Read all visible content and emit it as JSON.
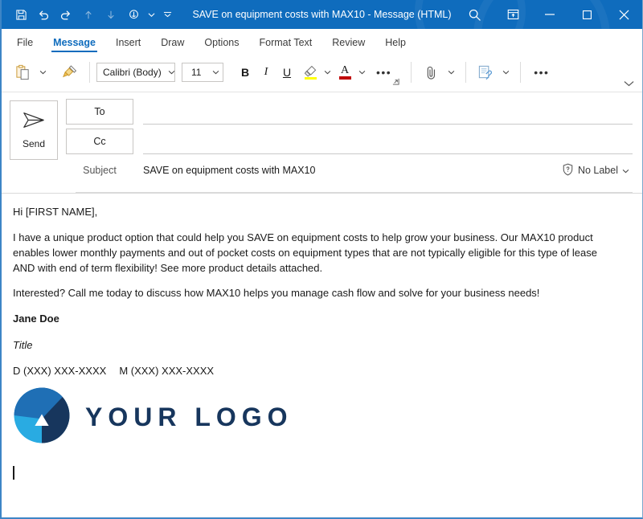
{
  "window": {
    "title": "SAVE on equipment costs with MAX10  -  Message (HTML)",
    "accent_color": "#0f6cbd",
    "border_color": "#3d85c6"
  },
  "quick_access": {
    "items": [
      {
        "name": "save-icon",
        "glyph": "⬚",
        "label": "Save",
        "dim": false
      },
      {
        "name": "undo-icon",
        "glyph": "↶",
        "label": "Undo",
        "dim": false
      },
      {
        "name": "redo-icon",
        "glyph": "↻",
        "label": "Redo",
        "dim": false
      },
      {
        "name": "move-up-icon",
        "glyph": "↑",
        "label": "Previous Item",
        "dim": true
      },
      {
        "name": "move-down-icon",
        "glyph": "↓",
        "label": "Next Item",
        "dim": true
      },
      {
        "name": "touch-mode-icon",
        "glyph": "☝",
        "label": "Touch/Mouse Mode",
        "dim": false
      },
      {
        "name": "touch-mode-caret-icon",
        "glyph": "ˇ",
        "label": "Touch Mode Options",
        "dim": false
      },
      {
        "name": "customize-qat-icon",
        "glyph": "⌄",
        "label": "Customize Quick Access Toolbar",
        "dim": false
      }
    ]
  },
  "window_controls": [
    {
      "name": "search-icon",
      "glyph": "⌕",
      "label": "Search"
    },
    {
      "name": "ribbon-display-options-icon",
      "glyph": "⧉",
      "label": "Ribbon Display Options"
    },
    {
      "name": "minimize-button",
      "glyph": "─",
      "label": "Minimize"
    },
    {
      "name": "maximize-button",
      "glyph": "□",
      "label": "Maximize"
    },
    {
      "name": "close-button",
      "glyph": "✕",
      "label": "Close"
    }
  ],
  "tabs": [
    {
      "id": "file",
      "label": "File",
      "active": false
    },
    {
      "id": "message",
      "label": "Message",
      "active": true
    },
    {
      "id": "insert",
      "label": "Insert",
      "active": false
    },
    {
      "id": "draw",
      "label": "Draw",
      "active": false
    },
    {
      "id": "options",
      "label": "Options",
      "active": false
    },
    {
      "id": "format-text",
      "label": "Format Text",
      "active": false
    },
    {
      "id": "review",
      "label": "Review",
      "active": false
    },
    {
      "id": "help",
      "label": "Help",
      "active": false
    }
  ],
  "ribbon": {
    "paste": {
      "icon": "paste-icon",
      "label": "Paste"
    },
    "format_painter": {
      "icon": "format-painter-icon",
      "label": "Format Painter"
    },
    "font_name": {
      "value": "Calibri (Body)",
      "label": "Font"
    },
    "font_size": {
      "value": "11",
      "label": "Font Size"
    },
    "bold": {
      "label": "B",
      "title": "Bold"
    },
    "italic": {
      "label": "I",
      "title": "Italic"
    },
    "underline": {
      "label": "U",
      "title": "Underline"
    },
    "highlight": {
      "label": "Text Highlight Color",
      "color": "#ffff00"
    },
    "font_color": {
      "label": "A",
      "title": "Font Color",
      "color": "#c00000"
    },
    "more_font": {
      "label": "•••",
      "title": "More Font Commands"
    },
    "font_launcher": {
      "label": "⬌",
      "title": "Font Dialog"
    },
    "attach_file": {
      "icon": "paperclip-icon",
      "label": "Attach File"
    },
    "sensitivity": {
      "icon": "sensitivity-icon",
      "label": "Sensitivity"
    },
    "more_commands": {
      "label": "•••",
      "title": "More Commands"
    },
    "collapse": {
      "label": "⌄",
      "title": "Collapse the Ribbon"
    }
  },
  "compose": {
    "send_button": {
      "label": "Send",
      "icon": "paper-plane-icon"
    },
    "to": {
      "label": "To",
      "value": "",
      "placeholder": ""
    },
    "cc": {
      "label": "Cc",
      "value": "",
      "placeholder": ""
    },
    "subject": {
      "label": "Subject",
      "value": "SAVE on equipment costs with MAX10",
      "placeholder": ""
    },
    "sensitivity_label": {
      "text": "No Label",
      "icon": "shield-question-icon",
      "caret": "ˇ"
    }
  },
  "body": {
    "greeting": "Hi [FIRST NAME],",
    "paragraph1": "I have a unique product option that could help you SAVE on equipment costs to help grow your business. Our MAX10 product enables lower monthly payments and out of pocket costs on equipment types that are not typically eligible for this type of lease AND with end of term flexibility! See more product details attached.",
    "paragraph2": "Interested? Call me today to discuss how MAX10 helps you manage cash flow and solve for your business needs!",
    "signature_name": "Jane Doe",
    "signature_title": "Title",
    "phone_direct": "D (XXX) XXX-XXXX",
    "phone_mobile": "M (XXX) XXX-XXXX",
    "logo_text": "YOUR LOGO",
    "logo_colors": {
      "light": "#29abe2",
      "medium": "#1f6fb5",
      "dark": "#17365d",
      "text": "#17365d"
    }
  }
}
